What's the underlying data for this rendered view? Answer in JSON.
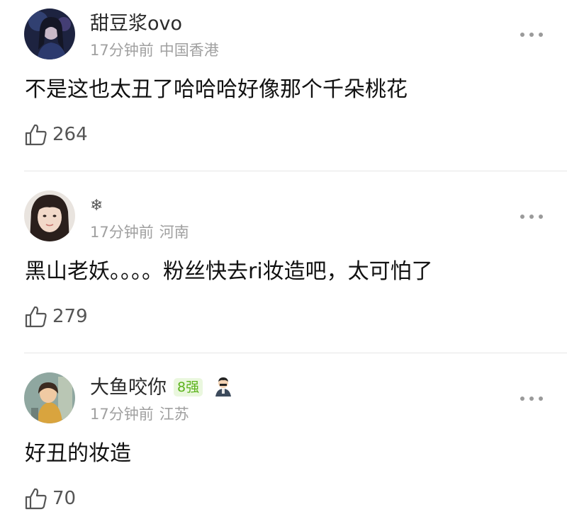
{
  "comments": [
    {
      "username": "甜豆浆ovo",
      "time": "17分钟前",
      "location": "中国香港",
      "text": "不是这也太丑了哈哈哈好像那个千朵桃花",
      "likes": "264"
    },
    {
      "username": "❄",
      "time": "17分钟前",
      "location": "河南",
      "text": "黑山老妖。。。。粉丝快去ri妆造吧，太可怕了",
      "likes": "279"
    },
    {
      "username": "大鱼咬你",
      "badge": "8强",
      "time": "17分钟前",
      "location": "江苏",
      "text": "好丑的妆造",
      "likes": "70"
    }
  ],
  "colors": {
    "badge_bg": "#eaf7de",
    "badge_text": "#5cb31c",
    "meta": "#a0a0a0",
    "divider": "#e6e6e6"
  },
  "icons": {
    "like": "thumbs-up-icon",
    "more": "more-dots-icon",
    "medal": "user-medal-icon"
  }
}
